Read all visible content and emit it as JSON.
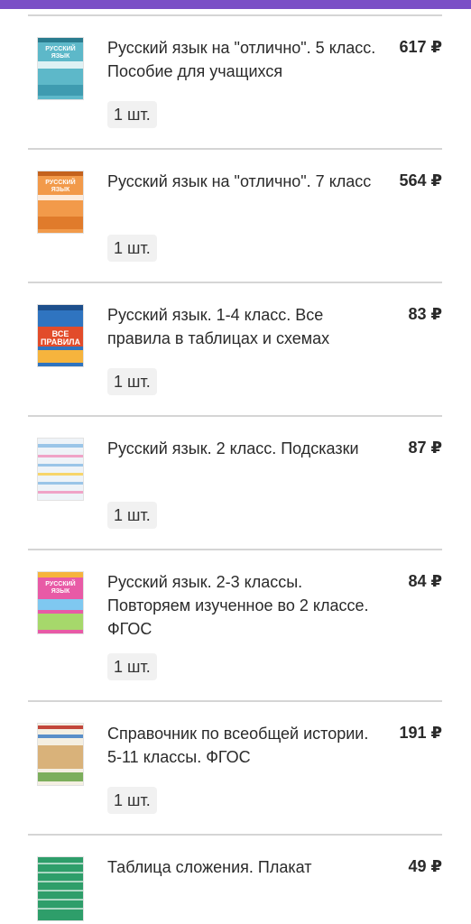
{
  "accent_color": "#7b4fc6",
  "currency_symbol": "₽",
  "items": [
    {
      "title": "Русский язык на \"отлично\". 5 класс. Пособие для учащихся",
      "price": "617 ₽",
      "qty": "1 шт.",
      "cover_icon": "book-cover-teal",
      "cover_text": "РУССКИЙ ЯЗЫК",
      "cover_color": "#5db8c9"
    },
    {
      "title": "Русский язык на \"отлично\". 7 класс",
      "price": "564 ₽",
      "qty": "1 шт.",
      "cover_icon": "book-cover-orange",
      "cover_text": "РУССКИЙ ЯЗЫК",
      "cover_color": "#f29a4a"
    },
    {
      "title": "Русский язык. 1-4 класс. Все правила в таблицах и схемах",
      "price": "83 ₽",
      "qty": "1 шт.",
      "cover_icon": "book-cover-blue-orange",
      "cover_text": "ВСЕ ПРАВИЛА",
      "cover_color": "#2f74c0"
    },
    {
      "title": "Русский язык. 2 класс. Подсказки",
      "price": "87 ₽",
      "qty": "1 шт.",
      "cover_icon": "book-cover-light",
      "cover_text": "",
      "cover_color": "#eef3f8"
    },
    {
      "title": "Русский язык. 2-3 классы. Повторяем изученное во 2 классе. ФГОС",
      "price": "84 ₽",
      "qty": "1 шт.",
      "cover_icon": "book-cover-pink",
      "cover_text": "РУССКИЙ ЯЗЫК",
      "cover_color": "#e85aa6"
    },
    {
      "title": "Справочник по всеобщей истории. 5-11 классы. ФГОС",
      "price": "191 ₽",
      "qty": "1 шт.",
      "cover_icon": "book-cover-history",
      "cover_text": "",
      "cover_color": "#f4efe2"
    },
    {
      "title": "Таблица сложения. Плакат",
      "price": "49 ₽",
      "qty": "",
      "cover_icon": "poster-cover-green",
      "cover_text": "",
      "cover_color": "#2e9e6a"
    }
  ]
}
